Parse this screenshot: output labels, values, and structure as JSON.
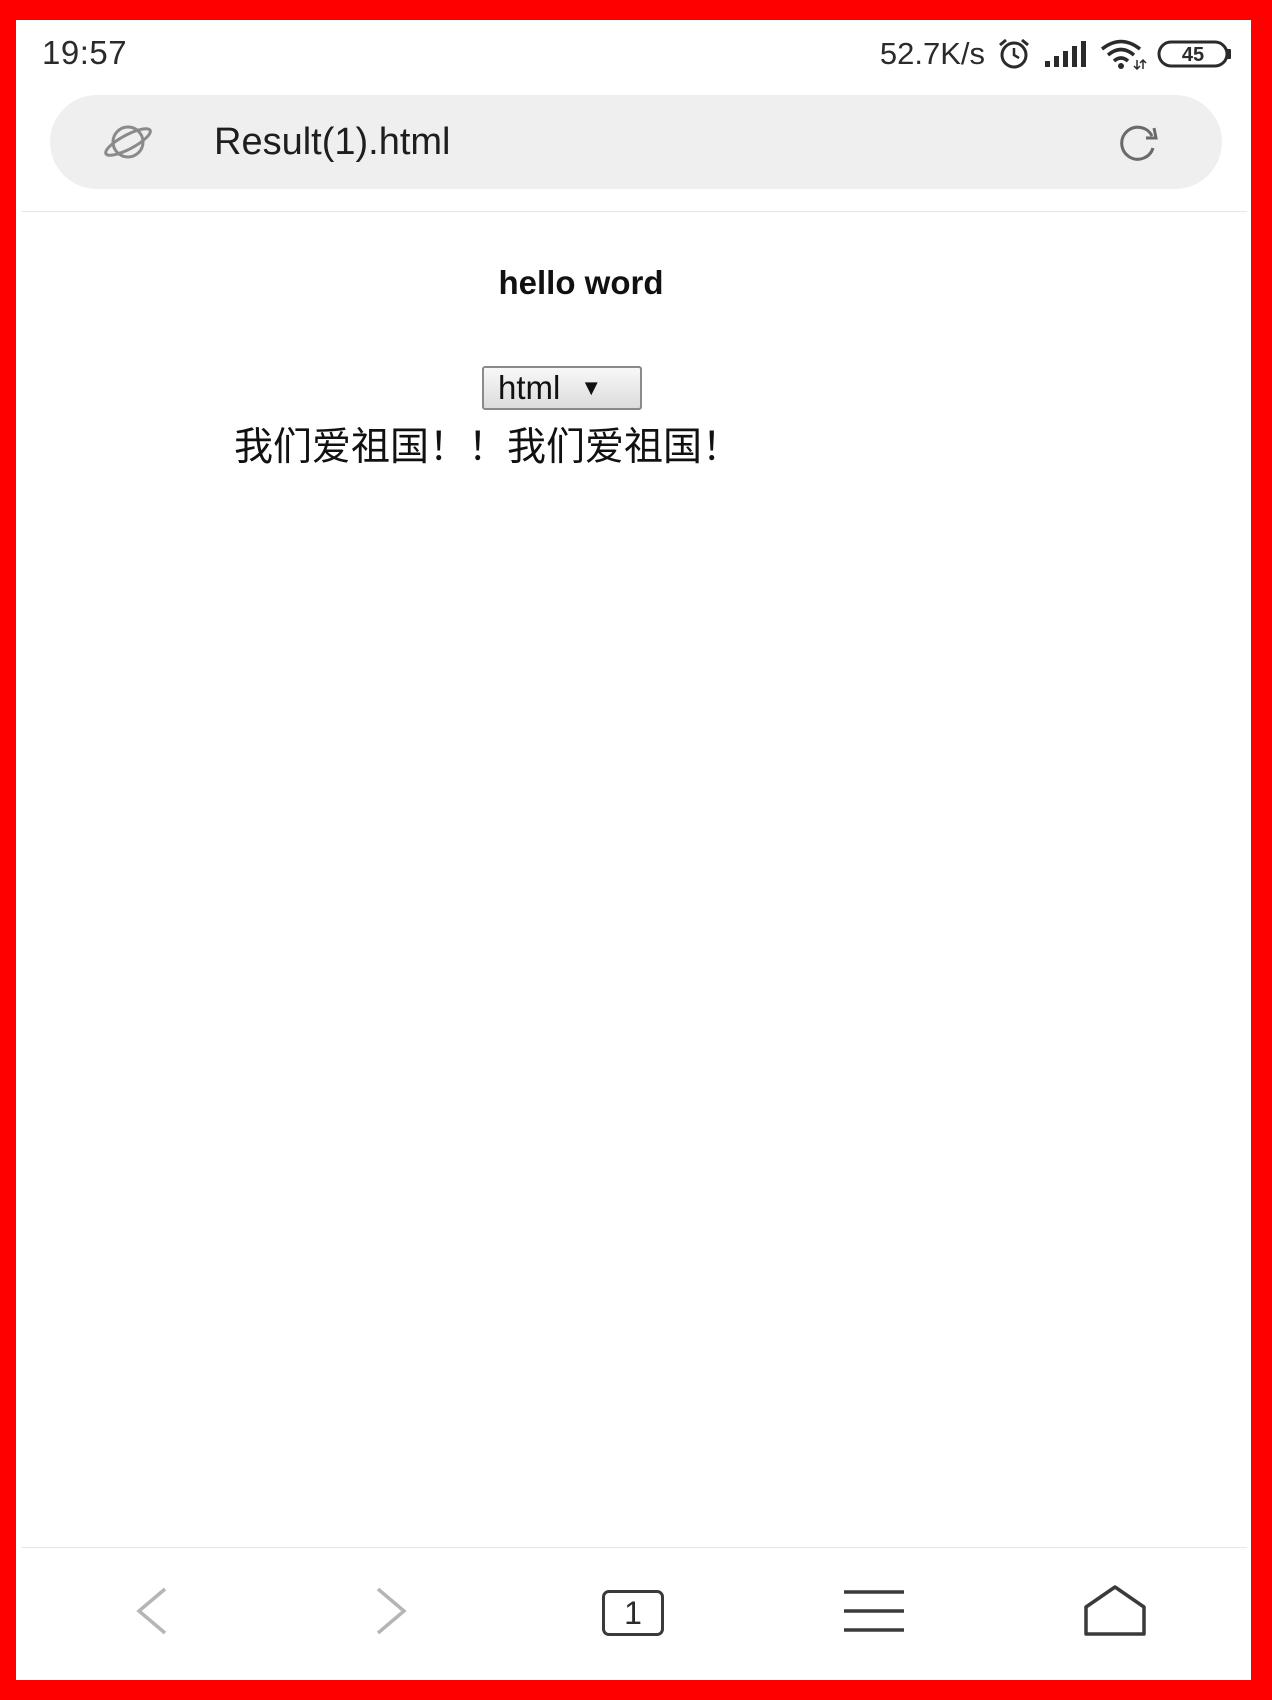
{
  "status_bar": {
    "time": "19:57",
    "network_speed": "52.7K/s",
    "battery_level": "45",
    "icons": [
      "alarm-icon",
      "signal-icon",
      "wifi-icon",
      "battery-icon"
    ]
  },
  "address_bar": {
    "title": "Result(1).html",
    "left_icon": "planet-icon",
    "right_icon": "reload-icon"
  },
  "page": {
    "heading": "hello word",
    "select_value": "html",
    "text": "我们爱祖国！！我们爱祖国！"
  },
  "bottom_nav": {
    "tab_count": "1",
    "icons": [
      "back-icon",
      "forward-icon",
      "tabs-icon",
      "menu-icon",
      "home-icon"
    ]
  },
  "colors": {
    "frame_border": "#ff0000",
    "address_bar_bg": "#efefef",
    "icon_gray": "#3a3a3a",
    "disabled_gray": "#b5b5b5"
  }
}
